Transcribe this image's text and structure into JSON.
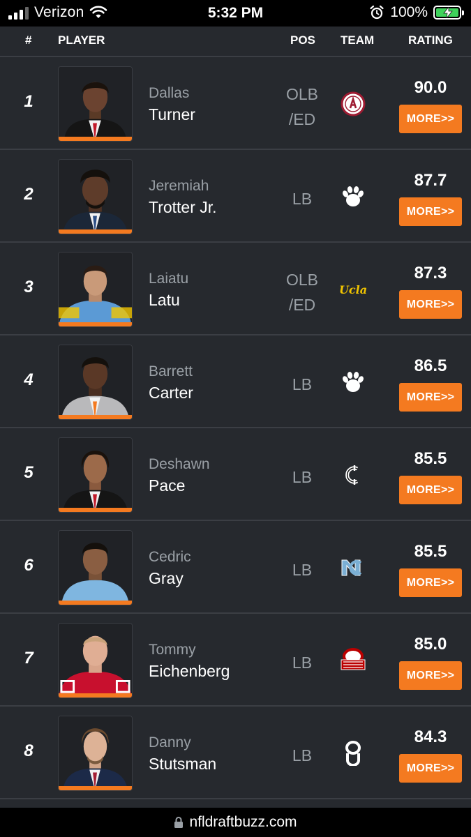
{
  "status_bar": {
    "carrier": "Verizon",
    "time": "5:32 PM",
    "battery": "100%"
  },
  "table": {
    "headers": {
      "rank": "#",
      "player": "PLAYER",
      "pos": "POS",
      "team": "TEAM",
      "rating": "RATING"
    },
    "more_label": "MORE>>",
    "rows": [
      {
        "rank": "1",
        "first": "Dallas",
        "last": "Turner",
        "pos_line1": "OLB",
        "pos_line2": "/ED",
        "team_icon": "alabama-logo-icon",
        "rating": "90.0"
      },
      {
        "rank": "2",
        "first": "Jeremiah",
        "last": "Trotter Jr.",
        "pos_line1": "LB",
        "pos_line2": "",
        "team_icon": "clemson-paw-icon",
        "rating": "87.7"
      },
      {
        "rank": "3",
        "first": "Laiatu",
        "last": "Latu",
        "pos_line1": "OLB",
        "pos_line2": "/ED",
        "team_icon": "ucla-logo-icon",
        "team_text": "Ucla",
        "rating": "87.3"
      },
      {
        "rank": "4",
        "first": "Barrett",
        "last": "Carter",
        "pos_line1": "LB",
        "pos_line2": "",
        "team_icon": "clemson-paw-icon",
        "rating": "86.5"
      },
      {
        "rank": "5",
        "first": "Deshawn",
        "last": "Pace",
        "pos_line1": "LB",
        "pos_line2": "",
        "team_icon": "cincinnati-logo-icon",
        "rating": "85.5"
      },
      {
        "rank": "6",
        "first": "Cedric",
        "last": "Gray",
        "pos_line1": "LB",
        "pos_line2": "",
        "team_icon": "north-carolina-logo-icon",
        "rating": "85.5"
      },
      {
        "rank": "7",
        "first": "Tommy",
        "last": "Eichenberg",
        "pos_line1": "LB",
        "pos_line2": "",
        "team_icon": "ohio-state-logo-icon",
        "rating": "85.0"
      },
      {
        "rank": "8",
        "first": "Danny",
        "last": "Stutsman",
        "pos_line1": "LB",
        "pos_line2": "",
        "team_icon": "oklahoma-logo-icon",
        "rating": "84.3"
      }
    ]
  },
  "url_bar": {
    "url": "nfldraftbuzz.com"
  },
  "colors": {
    "accent": "#f47a20",
    "background": "#26292e",
    "muted_text": "#9aa0a6",
    "battery_green": "#3fd25b"
  }
}
